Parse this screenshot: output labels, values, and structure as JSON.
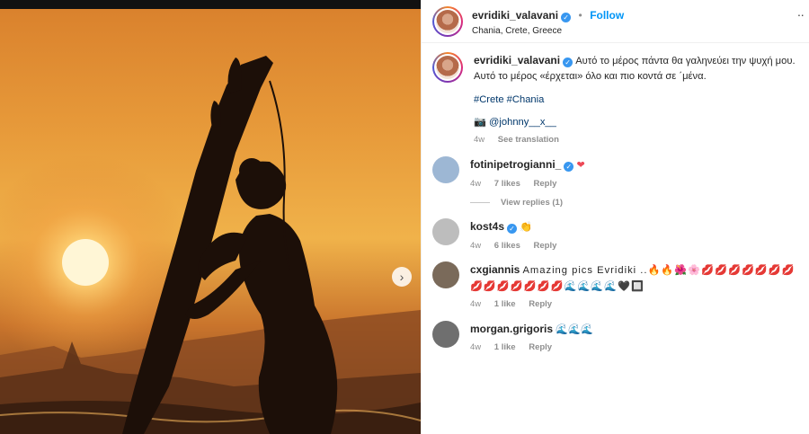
{
  "post": {
    "username": "evridiki_valavani",
    "follow_label": "Follow",
    "separator": "•",
    "location": "Chania, Crete, Greece",
    "more_label": "··"
  },
  "caption": {
    "username": "evridiki_valavani",
    "text": "Αυτό το μέρος πάντα θα γαληνεύει την ψυχή μου. Αυτό το μέρος «έρχεται» όλο και πιο κοντά σε ΄μένα.",
    "hashtags": "#Crete #Chania",
    "credit_icon": "📷",
    "credit": "@johnny__x__",
    "time": "4w",
    "translate_label": "See translation"
  },
  "comments": [
    {
      "username": "fotinipetrogianni_",
      "verified": true,
      "text": "❤",
      "time": "4w",
      "likes": "7 likes",
      "reply": "Reply",
      "view_replies": "View replies (1)",
      "avatar_color": "#9db7d4"
    },
    {
      "username": "kost4s",
      "verified": true,
      "text": "👏",
      "time": "4w",
      "likes": "6 likes",
      "reply": "Reply",
      "avatar_color": "#bdbdbd"
    },
    {
      "username": "cxgiannis",
      "verified": false,
      "text": "Amazing pics Evridiki ..🔥🔥🌺🌸💋💋💋💋💋💋💋💋💋💋💋💋💋💋🌊🌊🌊🌊🖤🔲",
      "time": "4w",
      "likes": "1 like",
      "reply": "Reply",
      "avatar_color": "#7a6a5a"
    },
    {
      "username": "morgan.grigoris",
      "verified": false,
      "text": "🌊🌊🌊",
      "time": "4w",
      "likes": "1 like",
      "reply": "Reply",
      "avatar_color": "#6f6f6f"
    }
  ],
  "colors": {
    "link": "#0095f6",
    "verified": "#3897f0",
    "muted": "#8e8e8e"
  },
  "icons": {
    "next": "chevron-right-icon",
    "verified": "verified-badge-icon",
    "more": "more-options-icon"
  }
}
